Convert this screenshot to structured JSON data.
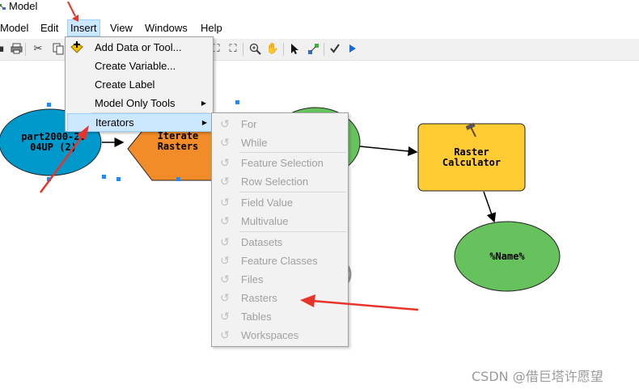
{
  "window": {
    "title": "Model"
  },
  "menubar": {
    "items": [
      "Model",
      "Edit",
      "Insert",
      "View",
      "Windows",
      "Help"
    ]
  },
  "insert_menu": {
    "items": [
      {
        "label": "Add Data or Tool...",
        "submenu": false
      },
      {
        "label": "Create Variable...",
        "submenu": false
      },
      {
        "label": "Create Label",
        "submenu": false
      },
      {
        "label": "Model Only Tools",
        "submenu": true
      },
      {
        "label": "Iterators",
        "submenu": true,
        "highlighted": true
      }
    ]
  },
  "iterators_menu": {
    "items": [
      {
        "label": "For",
        "enabled": false
      },
      {
        "label": "While",
        "enabled": false
      },
      {
        "label": "Feature Selection",
        "enabled": false
      },
      {
        "label": "Row Selection",
        "enabled": false
      },
      {
        "label": "Field Value",
        "enabled": false
      },
      {
        "label": "Multivalue",
        "enabled": false
      },
      {
        "label": "Datasets",
        "enabled": false
      },
      {
        "label": "Feature Classes",
        "enabled": false
      },
      {
        "label": "Files",
        "enabled": false
      },
      {
        "label": "Rasters",
        "enabled": false
      },
      {
        "label": "Tables",
        "enabled": false
      },
      {
        "label": "Workspaces",
        "enabled": false
      }
    ]
  },
  "model": {
    "input_node": {
      "label_line1": "part2000-20",
      "label_line2": "04UP (2)",
      "color": "#0099cc"
    },
    "iterator_node": {
      "label_line1": "Iterate",
      "label_line2": "Rasters",
      "color": "#f28c28"
    },
    "value_node": {
      "color": "#66c25c"
    },
    "tool_node": {
      "label_line1": "Raster",
      "label_line2": "Calculator",
      "color": "#ffcc33"
    },
    "output_node": {
      "label": "%Name%",
      "color": "#66c25c"
    }
  },
  "annotation": {
    "arrow_color": "#e8332a"
  },
  "watermark": "CSDN @借巨塔许愿望"
}
